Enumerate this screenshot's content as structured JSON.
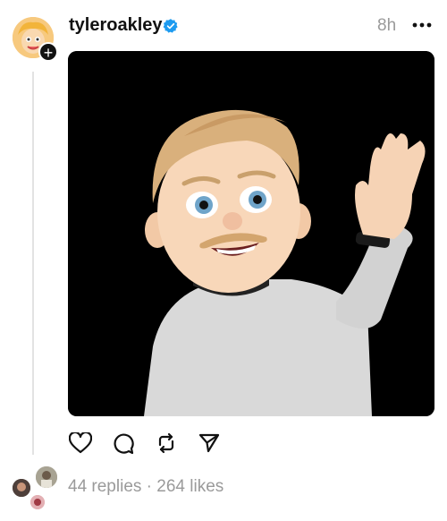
{
  "post": {
    "username": "tyleroakley",
    "timestamp": "8h",
    "stats": "44 replies · 264 likes"
  },
  "icons": {
    "verified": "verified-badge-icon",
    "more": "more-horizontal-icon",
    "like": "heart-icon",
    "reply": "comment-icon",
    "repost": "repost-icon",
    "share": "send-icon",
    "follow": "plus-icon"
  },
  "colors": {
    "verified": "#1d9bf0",
    "text_primary": "#111111",
    "text_secondary": "#9a9a9a"
  }
}
